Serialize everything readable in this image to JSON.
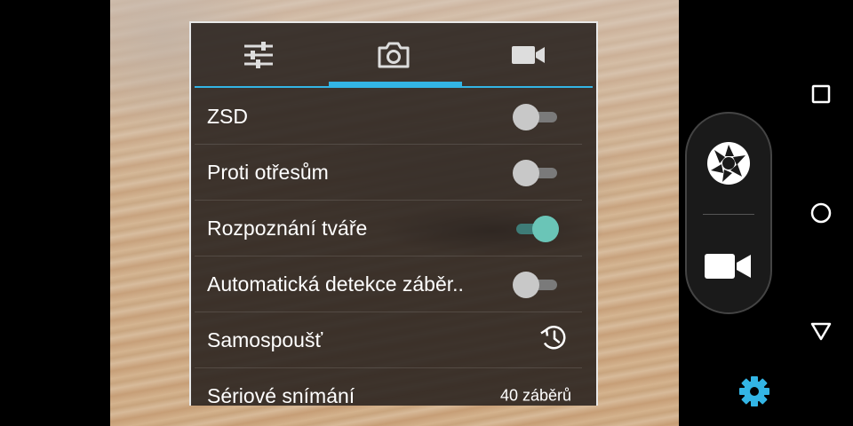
{
  "tabs": [
    {
      "icon": "sliders-icon",
      "active": false
    },
    {
      "icon": "camera-icon",
      "active": true
    },
    {
      "icon": "video-camera-icon",
      "active": false
    }
  ],
  "settings": [
    {
      "label": "ZSD",
      "control": "toggle",
      "on": false
    },
    {
      "label": "Proti otřesům",
      "control": "toggle",
      "on": false
    },
    {
      "label": "Rozpoznání tváře",
      "control": "toggle",
      "on": true
    },
    {
      "label": "Automatická detekce záběr..",
      "control": "toggle",
      "on": false
    },
    {
      "label": "Samospoušť",
      "control": "icon",
      "icon": "timer-icon"
    },
    {
      "label": "Sériové snímání",
      "control": "value",
      "value": "40 záběrů"
    }
  ],
  "controls": {
    "shutter_icon": "shutter-icon",
    "video_icon": "video-record-icon",
    "settings_icon": "gear-icon"
  },
  "navbar": [
    "recents-icon",
    "home-icon",
    "back-icon"
  ],
  "colors": {
    "accent": "#33b5e5",
    "toggle_on": "#6ac5b7",
    "gear": "#33b5e5"
  }
}
